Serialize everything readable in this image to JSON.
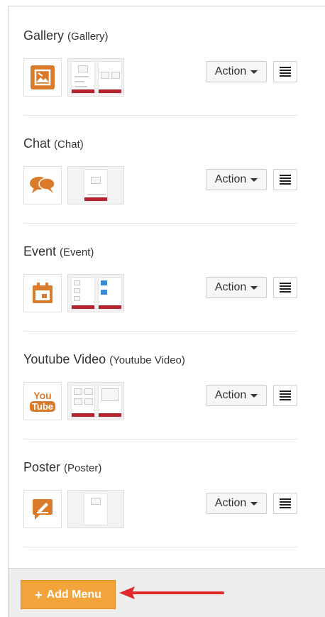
{
  "items": [
    {
      "name": "Gallery",
      "type": "(Gallery)",
      "icon": "gallery-icon",
      "action_label": "Action"
    },
    {
      "name": "Chat",
      "type": "(Chat)",
      "icon": "chat-icon",
      "action_label": "Action"
    },
    {
      "name": "Event",
      "type": "(Event)",
      "icon": "calendar-icon",
      "action_label": "Action"
    },
    {
      "name": "Youtube Video",
      "type": "(Youtube Video)",
      "icon": "youtube-icon",
      "icon_text_1": "You",
      "icon_text_2": "Tube",
      "action_label": "Action"
    },
    {
      "name": "Poster",
      "type": "(Poster)",
      "icon": "poster-icon",
      "action_label": "Action"
    }
  ],
  "footer": {
    "add_menu_label": "Add Menu",
    "add_icon": "plus-icon"
  },
  "colors": {
    "accent": "#d97b2b",
    "button": "#f2a33a",
    "arrow": "#e02a2a",
    "preview_bar": "#b32430"
  }
}
